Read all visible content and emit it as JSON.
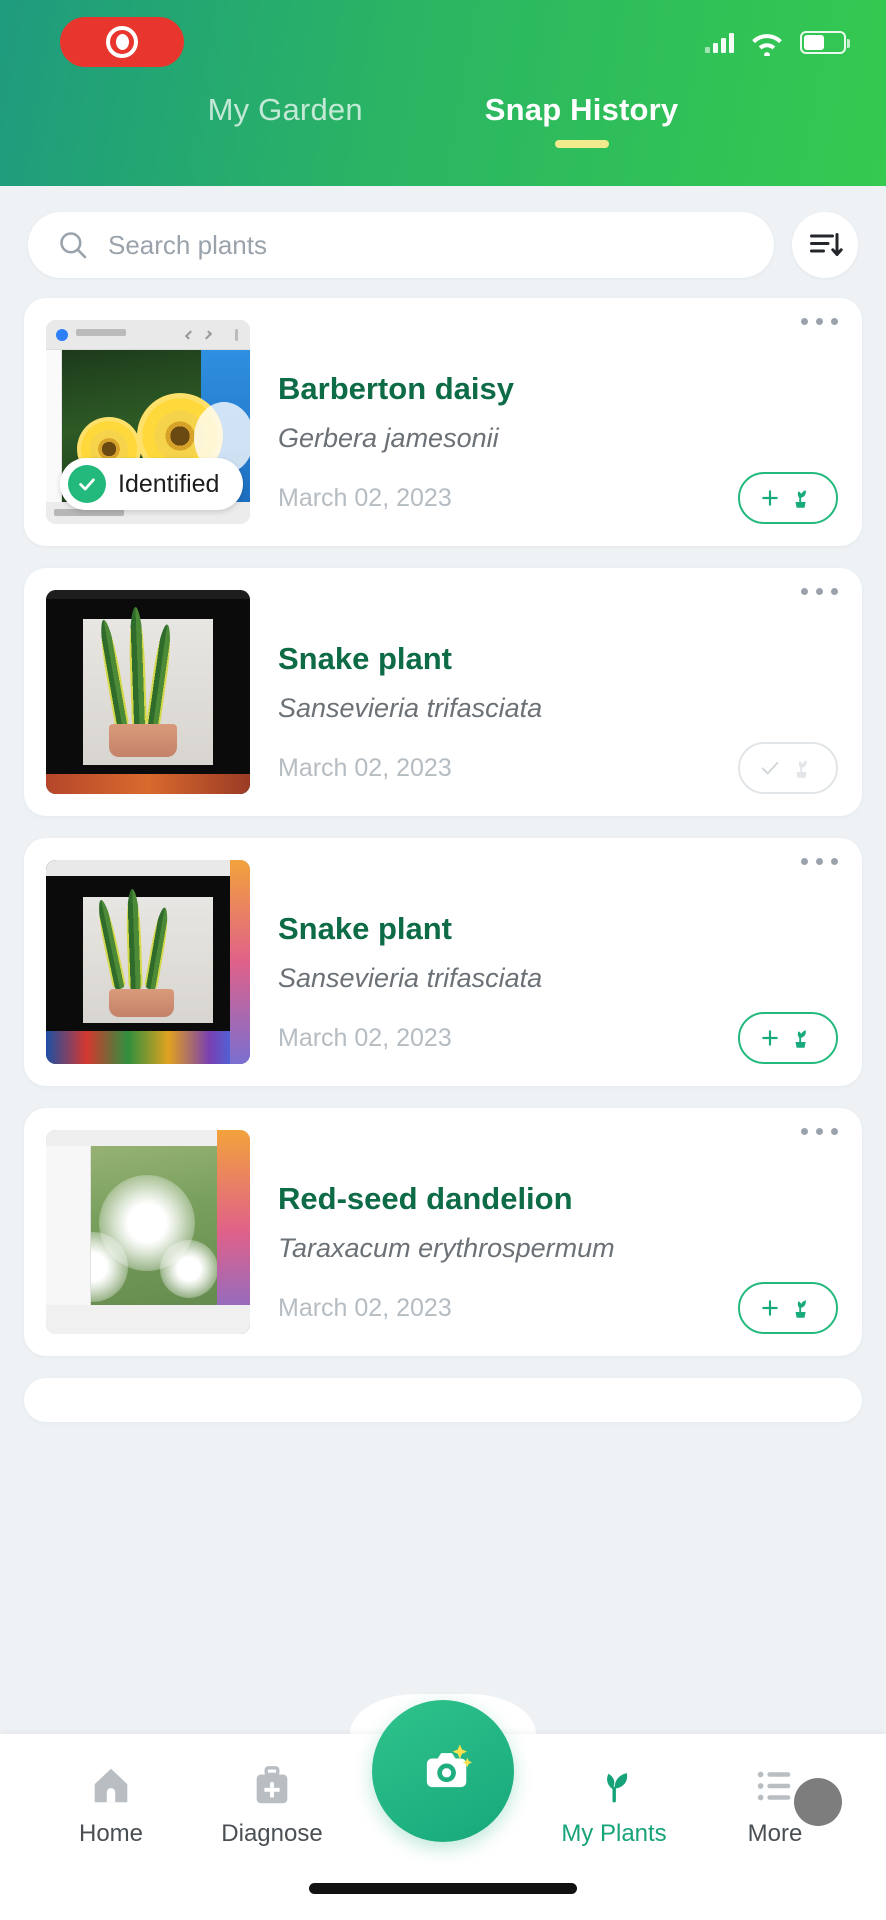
{
  "status_bar": {
    "recording_indicator": "record-pill",
    "signal_icon": "cellular-signal-icon",
    "wifi_icon": "wifi-icon",
    "battery_icon": "battery-icon"
  },
  "header": {
    "tabs": [
      {
        "label": "My Garden",
        "active": false
      },
      {
        "label": "Snap History",
        "active": true
      }
    ],
    "accent_color": "#2ab563",
    "underline_color": "#f2eb8d"
  },
  "search": {
    "placeholder": "Search plants",
    "value": "",
    "icon": "search-icon",
    "sort_icon": "sort-descending-icon"
  },
  "cards": [
    {
      "name": "Barberton daisy",
      "scientific_name": "Gerbera jamesonii",
      "date": "March 02, 2023",
      "badge": "Identified",
      "thumb": "daisy",
      "action": "add",
      "menu_icon": "more-options-icon"
    },
    {
      "name": "Snake plant",
      "scientific_name": "Sansevieria trifasciata",
      "date": "March 02, 2023",
      "badge": "",
      "thumb": "snake",
      "action": "added",
      "menu_icon": "more-options-icon"
    },
    {
      "name": "Snake plant",
      "scientific_name": "Sansevieria trifasciata",
      "date": "March 02, 2023",
      "badge": "",
      "thumb": "snake2",
      "action": "add",
      "menu_icon": "more-options-icon"
    },
    {
      "name": "Red-seed dandelion",
      "scientific_name": "Taraxacum erythrospermum",
      "date": "March 02, 2023",
      "badge": "",
      "thumb": "dandelion",
      "action": "add",
      "menu_icon": "more-options-icon"
    }
  ],
  "bottom_nav": {
    "items": [
      {
        "label": "Home",
        "icon": "home-icon",
        "active": false
      },
      {
        "label": "Diagnose",
        "icon": "first-aid-kit-icon",
        "active": false
      },
      {
        "label": "My Plants",
        "icon": "sprout-icon",
        "active": true
      },
      {
        "label": "More",
        "icon": "list-menu-icon",
        "active": false
      }
    ],
    "camera_button": "camera-capture-icon",
    "active_color": "#17a37a"
  }
}
